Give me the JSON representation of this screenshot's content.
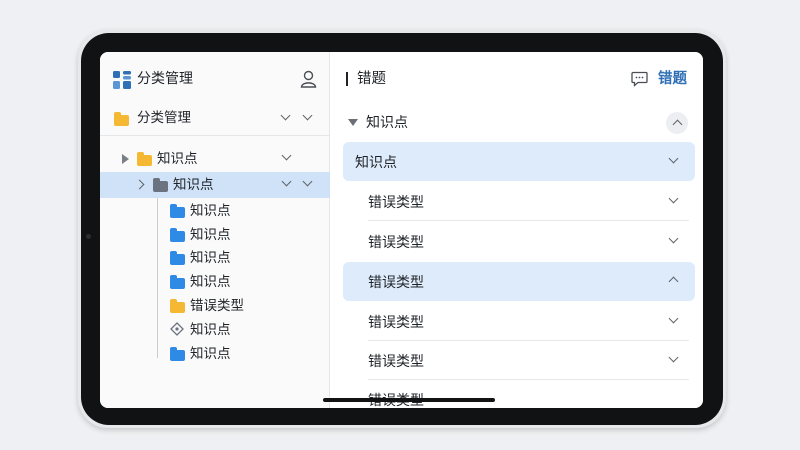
{
  "sidebar": {
    "app_title": "分类管理",
    "category_row": "分类管理",
    "tree": [
      {
        "label": "知识点"
      },
      {
        "label": "知识点"
      },
      {
        "label": "知识点"
      },
      {
        "label": "知识点"
      },
      {
        "label": "知识点"
      },
      {
        "label": "知识点"
      },
      {
        "label": "错误类型"
      },
      {
        "label": "知识点"
      },
      {
        "label": "知识点"
      }
    ]
  },
  "main": {
    "header_title": "错题",
    "header_action": "错题",
    "section_title": "知识点",
    "rows": [
      {
        "label": "知识点"
      },
      {
        "label": "错误类型"
      },
      {
        "label": "错误类型"
      },
      {
        "label": "错误类型"
      },
      {
        "label": "错误类型"
      },
      {
        "label": "错误类型"
      },
      {
        "label": "错误类型"
      }
    ]
  },
  "colors": {
    "accent": "#2f6fb5",
    "highlight": "#deebfb",
    "folder_blue": "#2f8ae6",
    "folder_yellow": "#f5b833"
  },
  "icons": [
    "grid-app-icon",
    "user-icon",
    "folder-icon",
    "chevron-down-icon",
    "chevron-up-icon",
    "triangle-right-icon",
    "triangle-down-icon",
    "message-icon",
    "tag-icon"
  ]
}
